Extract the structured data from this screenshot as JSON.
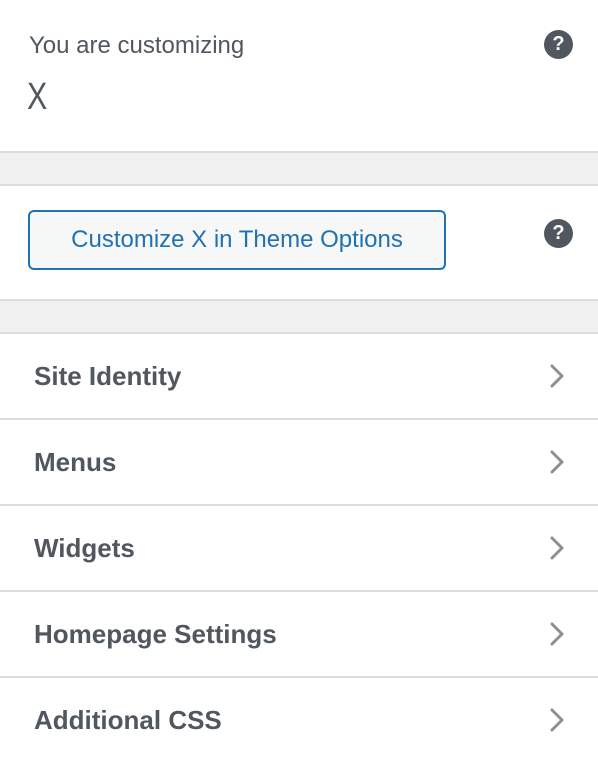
{
  "header": {
    "customizing_label": "You are customizing",
    "theme_name": "X",
    "help_icon": "question-circle-icon"
  },
  "theme_options": {
    "button_label": "Customize X in Theme Options",
    "help_icon": "question-circle-icon"
  },
  "sections": {
    "items": [
      {
        "label": "Site Identity",
        "icon": "chevron-right-icon"
      },
      {
        "label": "Menus",
        "icon": "chevron-right-icon"
      },
      {
        "label": "Widgets",
        "icon": "chevron-right-icon"
      },
      {
        "label": "Homepage Settings",
        "icon": "chevron-right-icon"
      },
      {
        "label": "Additional CSS",
        "icon": "chevron-right-icon"
      }
    ]
  },
  "colors": {
    "accent": "#2271b1",
    "text": "#50575e",
    "divider": "#dcdcde",
    "gap_background": "#f0f0f1",
    "chevron": "#8c8f94"
  }
}
